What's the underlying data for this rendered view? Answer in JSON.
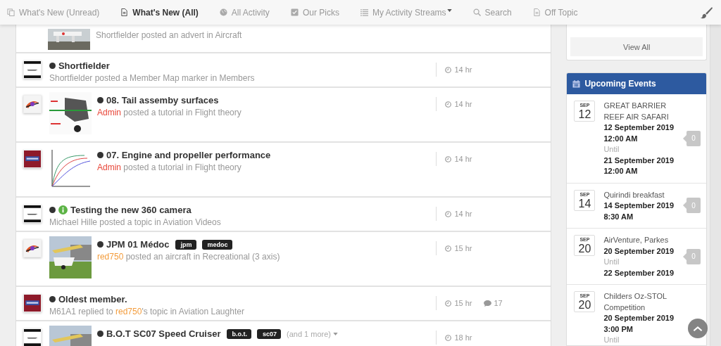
{
  "nav": [
    {
      "label": "What's New (Unread)",
      "selected": false,
      "dropdown": false
    },
    {
      "label": "What's New (All)",
      "selected": true,
      "dropdown": false
    },
    {
      "label": "All Activity",
      "selected": false,
      "dropdown": false
    },
    {
      "label": "Our Picks",
      "selected": false,
      "dropdown": false
    },
    {
      "label": "My Activity Streams",
      "selected": false,
      "dropdown": true
    },
    {
      "label": "Search",
      "selected": false,
      "dropdown": false
    },
    {
      "label": "Off Topic",
      "selected": false,
      "dropdown": false
    }
  ],
  "stream": {
    "fragment": {
      "thumbnail": true,
      "byline": [
        {
          "text": "Shortfielder posted an advert in Aircraft"
        }
      ]
    },
    "items": [
      {
        "unread": true,
        "title": "Shortfielder",
        "thumbnail": false,
        "byline": [
          {
            "text": "Shortfielder posted a Member Map marker in Members"
          }
        ],
        "time": "14 hr"
      },
      {
        "unread": true,
        "title": "08. Tail assemby surfaces",
        "thumbnail": true,
        "byline": [
          {
            "text": "Admin",
            "color": "#e8473a"
          },
          {
            "text": " posted a tutorial in Flight theory"
          }
        ],
        "time": "14 hr"
      },
      {
        "unread": true,
        "title": "07. Engine and propeller performance",
        "thumbnail": true,
        "byline": [
          {
            "text": "Admin",
            "color": "#e8473a"
          },
          {
            "text": " posted a tutorial in Flight theory"
          }
        ],
        "time": "14 hr"
      },
      {
        "unread": true,
        "info": true,
        "title": "Testing the new 360 camera",
        "thumbnail": false,
        "byline": [
          {
            "text": "Michael Hille posted a topic in Aviation Videos"
          }
        ],
        "time": "14 hr"
      },
      {
        "unread": true,
        "title": "JPM 01 Médoc",
        "tags": [
          "jpm",
          "medoc"
        ],
        "thumbnail": true,
        "byline": [
          {
            "text": "red750",
            "color": "#f39c3c"
          },
          {
            "text": " posted an aircraft in Recreational (3 axis)"
          }
        ],
        "time": "15 hr"
      },
      {
        "unread": true,
        "title": "Oldest member.",
        "thumbnail": false,
        "byline": [
          {
            "text": "M61A1 replied to "
          },
          {
            "text": "red750",
            "color": "#f39c3c"
          },
          {
            "text": "'s topic in Aviation Laughter"
          }
        ],
        "time": "15 hr",
        "comments": "17"
      },
      {
        "unread": true,
        "title": "B.O.T SC07 Speed Cruiser",
        "tags": [
          "b.o.t.",
          "sc07"
        ],
        "more": "(and 1 more)",
        "thumbnail": true,
        "time": "18 hr"
      }
    ]
  },
  "sidebar": {
    "view_all": "View All",
    "events_title": "Upcoming Events",
    "events": [
      {
        "month": "SEP",
        "day": "12",
        "title": "GREAT BARRIER REEF AIR SAFARI",
        "start": "12 September 2019 12:00 AM",
        "until": "Until",
        "end": "21 September 2019 12:00 AM",
        "comments": "0"
      },
      {
        "month": "SEP",
        "day": "14",
        "title": "Quirindi breakfast",
        "start": "14 September 2019 8:30 AM",
        "comments": "0"
      },
      {
        "month": "SEP",
        "day": "20",
        "title": "AirVenture, Parkes",
        "start": "20 September 2019",
        "until": "Until",
        "end": "22 September 2019",
        "comments": "0"
      },
      {
        "month": "SEP",
        "day": "20",
        "title": "Childers Oz-STOL Competition",
        "start": "20 September 2019 3:00 PM",
        "until": "Until"
      }
    ]
  }
}
